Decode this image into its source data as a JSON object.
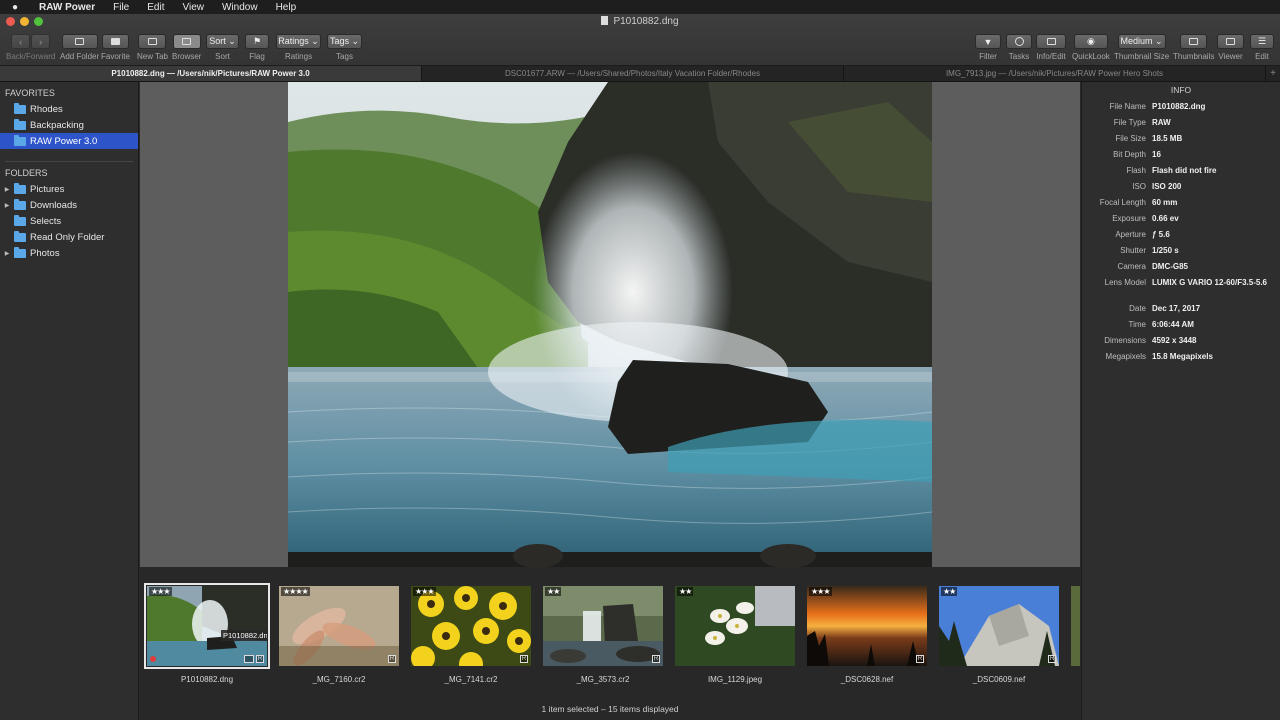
{
  "menubar": {
    "apple": "",
    "app": "RAW Power",
    "items": [
      "File",
      "Edit",
      "View",
      "Window",
      "Help"
    ]
  },
  "window": {
    "title": "P1010882.dng"
  },
  "toolbar": {
    "back_forward": "Back/Forward",
    "add_folder": "Add Folder",
    "favorite": "Favorite",
    "new_tab": "New Tab",
    "browser": "Browser",
    "sort_btn": "Sort ⌄",
    "sort": "Sort",
    "flag": "Flag",
    "ratings_btn": "Ratings ⌄",
    "ratings": "Ratings",
    "tags_btn": "Tags ⌄",
    "tags": "Tags",
    "filter": "Filter",
    "tasks": "Tasks",
    "info_edit": "Info/Edit",
    "quicklook": "QuickLook",
    "thumb_size_btn": "Medium ⌄",
    "thumb_size": "Thumbnail Size",
    "thumbnails": "Thumbnails",
    "viewer": "Viewer",
    "edit": "Edit"
  },
  "tabs": [
    "P1010882.dng  —  /Users/nik/Pictures/RAW Power 3.0",
    "DSC01677.ARW  —  /Users/Shared/Photos/Italy Vacation Folder/Rhodes",
    "IMG_7913.jpg  —  /Users/nik/Pictures/RAW Power Hero Shots"
  ],
  "sidebar": {
    "favorites_title": "FAVORITES",
    "favorites": [
      "Rhodes",
      "Backpacking",
      "RAW Power 3.0"
    ],
    "folders_title": "FOLDERS",
    "folders": [
      "Pictures",
      "Downloads",
      "Selects",
      "Read Only Folder",
      "Photos"
    ]
  },
  "info": {
    "title": "INFO",
    "rows": [
      {
        "k": "File Name",
        "v": "P1010882.dng"
      },
      {
        "k": "File Type",
        "v": "RAW"
      },
      {
        "k": "File Size",
        "v": "18.5 MB"
      },
      {
        "k": "Bit Depth",
        "v": "16"
      },
      {
        "k": "Flash",
        "v": "Flash did not fire"
      },
      {
        "k": "ISO",
        "v": "ISO 200"
      },
      {
        "k": "Focal Length",
        "v": "60 mm"
      },
      {
        "k": "Exposure",
        "v": "0.66 ev"
      },
      {
        "k": "Aperture",
        "v": "ƒ 5.6"
      },
      {
        "k": "Shutter",
        "v": "1/250 s"
      },
      {
        "k": "Camera",
        "v": "DMC-G85"
      },
      {
        "k": "Lens Model",
        "v": "LUMIX G VARIO 12-60/F3.5-5.6"
      }
    ],
    "rows2": [
      {
        "k": "Date",
        "v": "Dec 17, 2017"
      },
      {
        "k": "Time",
        "v": "6:06:44 AM"
      },
      {
        "k": "Dimensions",
        "v": "4592 x 3448"
      },
      {
        "k": "Megapixels",
        "v": "15.8 Megapixels"
      }
    ]
  },
  "filmstrip": {
    "items": [
      {
        "name": "P1010882.dng",
        "stars": "★★★"
      },
      {
        "name": "_MG_7160.cr2",
        "stars": "★★★★"
      },
      {
        "name": "_MG_7141.cr2",
        "stars": "★★★"
      },
      {
        "name": "_MG_3573.cr2",
        "stars": "★★"
      },
      {
        "name": "IMG_1129.jpeg",
        "stars": "★★"
      },
      {
        "name": "_DSC0628.nef",
        "stars": "★★★"
      },
      {
        "name": "_DSC0609.nef",
        "stars": "★★"
      }
    ],
    "tooltip": "P1010882.dng",
    "badge_r": "R",
    "status": "1 item selected – 15 items displayed"
  },
  "colors": {
    "selection": "#2d55c9",
    "folder": "#5aa8e8",
    "red_flag": "#e23b3b"
  }
}
